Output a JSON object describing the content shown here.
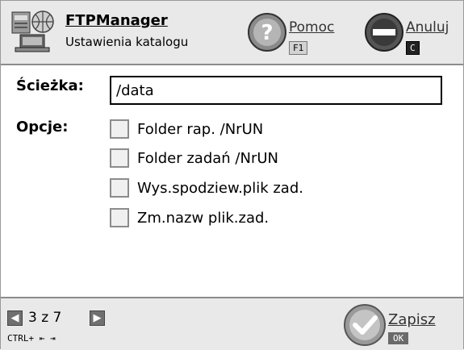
{
  "header": {
    "app_name": "FTPManager",
    "subtitle": "Ustawienia katalogu",
    "help": {
      "label": "Pomoc",
      "key": "F1"
    },
    "cancel": {
      "label": "Anuluj",
      "key": "C"
    }
  },
  "form": {
    "path_label": "Ścieżka:",
    "path_value": "/data",
    "options_label": "Opcje:",
    "options": [
      {
        "label": "Folder rap. /NrUN",
        "checked": false
      },
      {
        "label": "Folder zadań /NrUN",
        "checked": false
      },
      {
        "label": "Wys.spodziew.plik zad.",
        "checked": false
      },
      {
        "label": "Zm.nazw plik.zad.",
        "checked": false
      }
    ]
  },
  "footer": {
    "page_indicator": "3 z 7",
    "shortcut": "CTRL+ ⇤ ⇥",
    "save": {
      "label": "Zapisz",
      "key": "OK"
    }
  }
}
